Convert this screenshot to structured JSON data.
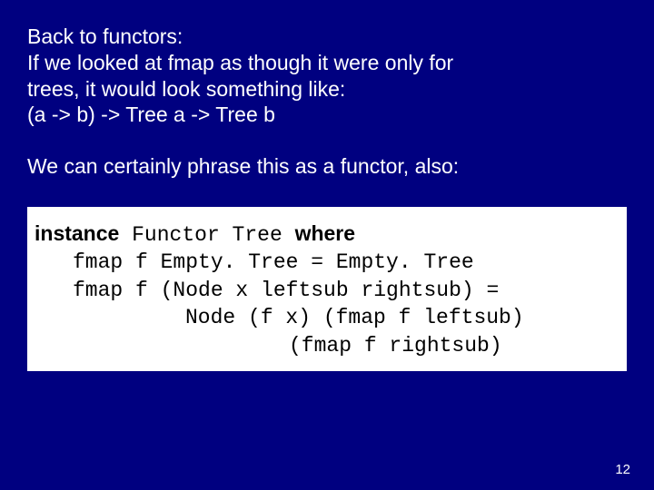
{
  "para1_l1": "Back to functors:",
  "para1_l2": "If we looked at fmap as though it were only for",
  "para1_l3": "trees, it would look something like:",
  "para1_l4": "(a -> b) -> Tree a -> Tree b",
  "para2_l1": "We can certainly phrase this as a functor, also:",
  "code": {
    "kw_instance": "instance",
    "functor_tree": " Functor Tree ",
    "kw_where": "where",
    "l2": "fmap f Empty. Tree = Empty. Tree",
    "l3": "fmap f (Node x leftsub rightsub) =",
    "l4": "Node (f x) (fmap f leftsub)",
    "l5": "(fmap f rightsub)"
  },
  "pagenum": "12"
}
